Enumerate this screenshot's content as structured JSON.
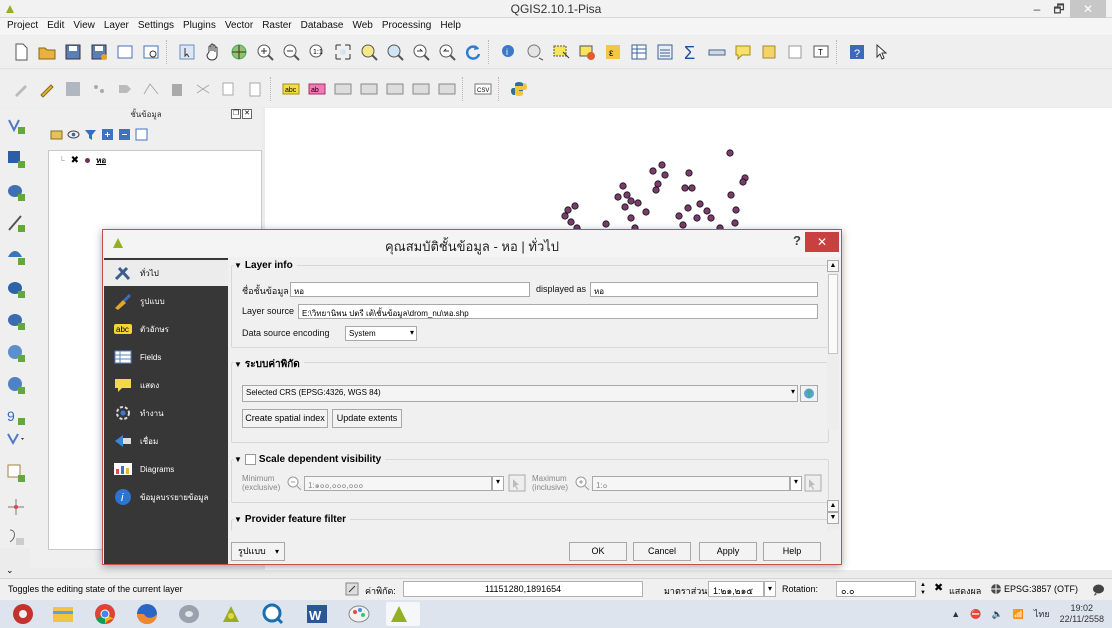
{
  "window": {
    "title": "QGIS2.10.1-Pisa",
    "minimize": "–",
    "maximize": "🗗",
    "close": "✕"
  },
  "menubar": [
    "Project",
    "Edit",
    "View",
    "Layer",
    "Settings",
    "Plugins",
    "Vector",
    "Raster",
    "Database",
    "Web",
    "Processing",
    "Help"
  ],
  "layers_panel": {
    "title": "ชั้นข้อมูล",
    "layer_name": "หอ"
  },
  "dialog": {
    "title": "คุณสมบัติชั้นข้อมูล - หอ | ทั่วไป",
    "help": "?",
    "close": "✕",
    "sidebar": [
      {
        "label": "ทั่วไป",
        "icon": "tools-icon"
      },
      {
        "label": "รูปแบบ",
        "icon": "style-icon"
      },
      {
        "label": "ตัวอักษร",
        "icon": "labels-icon"
      },
      {
        "label": "Fields",
        "icon": "fields-icon"
      },
      {
        "label": "แสดง",
        "icon": "display-icon"
      },
      {
        "label": "ทำงาน",
        "icon": "actions-icon"
      },
      {
        "label": "เชื่อม",
        "icon": "joins-icon"
      },
      {
        "label": "Diagrams",
        "icon": "diagrams-icon"
      },
      {
        "label": "ข้อมูลบรรยายข้อมูล",
        "icon": "metadata-icon"
      }
    ],
    "layer_info": {
      "header": "Layer info",
      "name_label": "ชื่อชั้นข้อมูล",
      "name_value": "หอ",
      "displayed_as_label": "displayed as",
      "displayed_as_value": "หอ",
      "source_label": "Layer source",
      "source_value": "E:\\วิทยานิพน ปตรี เต้\\ชั้นข้อมูล\\drom_nu\\หอ.shp",
      "encoding_label": "Data source encoding",
      "encoding_value": "System"
    },
    "crs": {
      "header": "ระบบค่าพิกัด",
      "selected": "Selected CRS (EPSG:4326, WGS 84)",
      "spatial_index_btn": "Create spatial index",
      "update_extents_btn": "Update extents"
    },
    "scale": {
      "header": "Scale dependent visibility",
      "min_label_1": "Minimum",
      "min_label_2": "(exclusive)",
      "min_value": "1:๑๐๐,๐๐๐,๐๐๐",
      "max_label_1": "Maximum",
      "max_label_2": "(inclusive)",
      "max_value": "1:๐"
    },
    "filter": {
      "header": "Provider feature filter"
    },
    "footer": {
      "style_btn": "รูปแบบ",
      "ok": "OK",
      "cancel": "Cancel",
      "apply": "Apply",
      "help": "Help"
    }
  },
  "statusbar": {
    "message": "Toggles the editing state of the current layer",
    "coord_label": "ค่าพิกัด:",
    "coord_value": "11151280,1891654",
    "scale_label": "มาตราส่วน",
    "scale_value": "1:๒๑,๒๑๕",
    "rotation_label": "Rotation:",
    "rotation_value": "๐.๐",
    "render_label": "แสดงผล",
    "crs_value": "EPSG:3857 (OTF)"
  },
  "taskbar": {
    "time": "19:02",
    "date": "22/11/2558",
    "lang": "ไทย"
  },
  "colors": {
    "accent_close": "#c94040",
    "sidebar_bg": "#373737",
    "point_fill": "#7b3b6c"
  }
}
